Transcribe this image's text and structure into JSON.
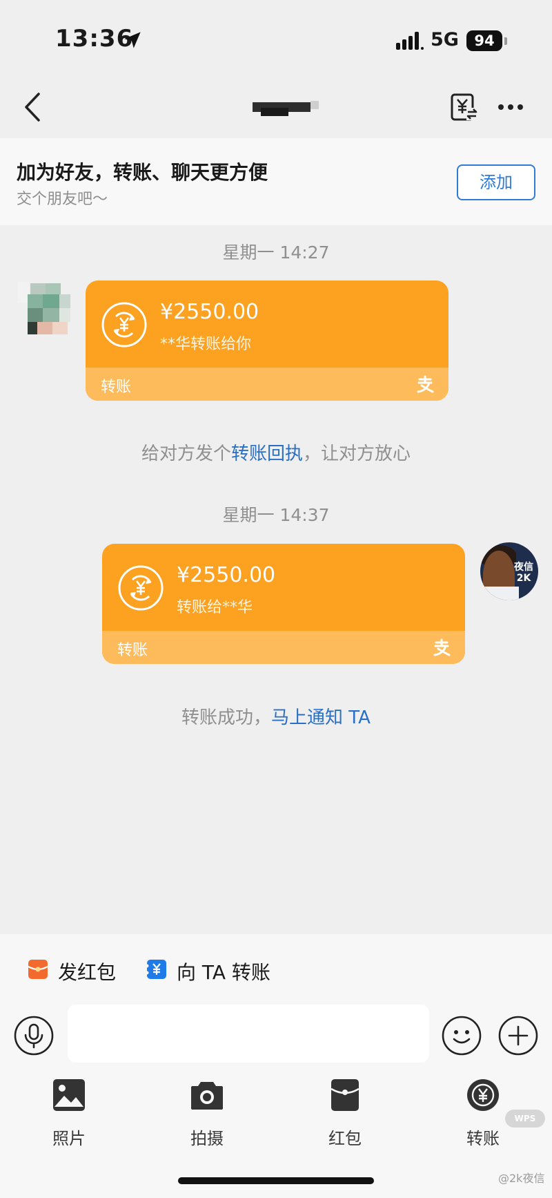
{
  "status_bar": {
    "time": "13:36",
    "network": "5G",
    "battery": "94"
  },
  "banner": {
    "title": "加为好友，转账、聊天更方便",
    "subtitle": "交个朋友吧～",
    "add_label": "添加"
  },
  "messages": [
    {
      "timestamp": "星期一 14:27",
      "amount": "¥2550.00",
      "desc": "**华转账给你",
      "label": "转账"
    },
    {
      "timestamp": "星期一 14:37",
      "amount": "¥2550.00",
      "desc": "转账给**华",
      "label": "转账"
    }
  ],
  "hints": {
    "receipt_prefix": "给对方发个",
    "receipt_link": "转账回执",
    "receipt_suffix": "，让对方放心",
    "success_prefix": "转账成功，",
    "success_link": "马上通知 TA"
  },
  "avatar_right_text": "夜信 2K",
  "quick_actions": [
    {
      "label": "发红包",
      "icon": "red-packet-icon",
      "color": "#f26a2e"
    },
    {
      "label": "向 TA 转账",
      "icon": "transfer-yuan-icon",
      "color": "#1f7be8"
    }
  ],
  "input": {
    "placeholder": ""
  },
  "tools": [
    {
      "label": "照片",
      "icon": "photo-icon"
    },
    {
      "label": "拍摄",
      "icon": "camera-icon"
    },
    {
      "label": "红包",
      "icon": "red-packet-icon"
    },
    {
      "label": "转账",
      "icon": "transfer-icon"
    }
  ],
  "watermark": {
    "text": "@2k夜信",
    "badge": "WPS"
  },
  "colors": {
    "card": "#fda121",
    "card_bottom": "#fdbb5b",
    "link": "#2a6fc6"
  }
}
